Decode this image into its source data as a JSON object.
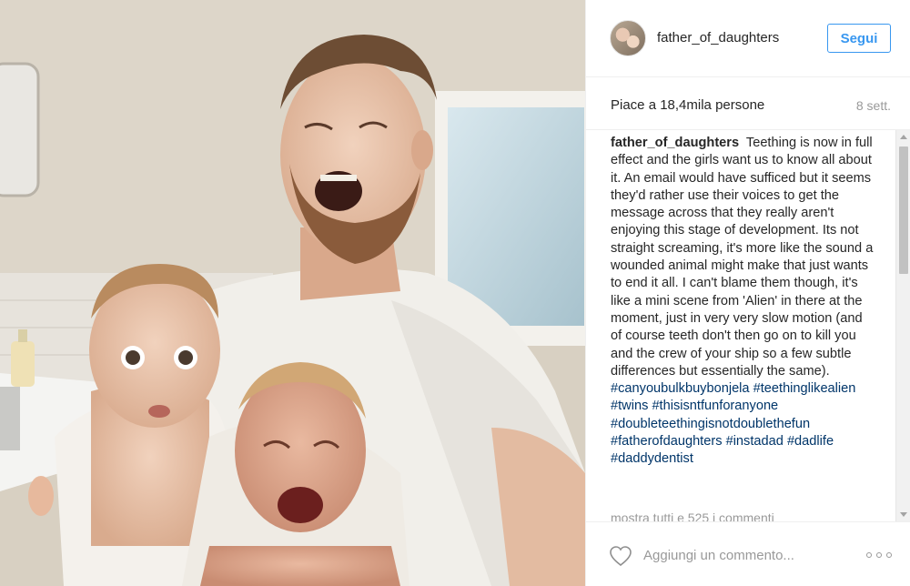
{
  "post": {
    "username": "father_of_daughters",
    "follow_label": "Segui",
    "likes_text": "Piace a 18,4mila persone",
    "timestamp": "8 sett.",
    "caption_user": "father_of_daughters",
    "caption_text": "Teething is now in full effect and the girls want us to know all about it. An email would have sufficed but it seems they'd rather use their voices to get the message across that they really aren't enjoying this stage of development. Its not straight screaming, it's more like the sound a wounded animal might make that just wants to end it all. I can't blame them though, it's like a mini scene from 'Alien' in there at the moment, just in very very slow motion (and of course teeth don't then go on to kill you and the crew of your ship so a few subtle differences but essentially the same).",
    "hashtags": [
      "#canyoubulkbuybonjela",
      "#teethinglikealien",
      "#twins",
      "#thisisntfunforanyone",
      "#doubleteethingisnotdoublethefun",
      "#fatherofdaughters",
      "#instadad",
      "#dadlife",
      "#daddydentist"
    ],
    "show_all_comments": "mostra tutti e 525 i commenti",
    "comment_placeholder": "Aggiungi un commento..."
  },
  "colors": {
    "accent": "#3897f0",
    "hashtag": "#003569",
    "muted": "#999999",
    "text": "#262626"
  },
  "icons": {
    "like": "heart-icon",
    "more": "more-options-icon"
  }
}
